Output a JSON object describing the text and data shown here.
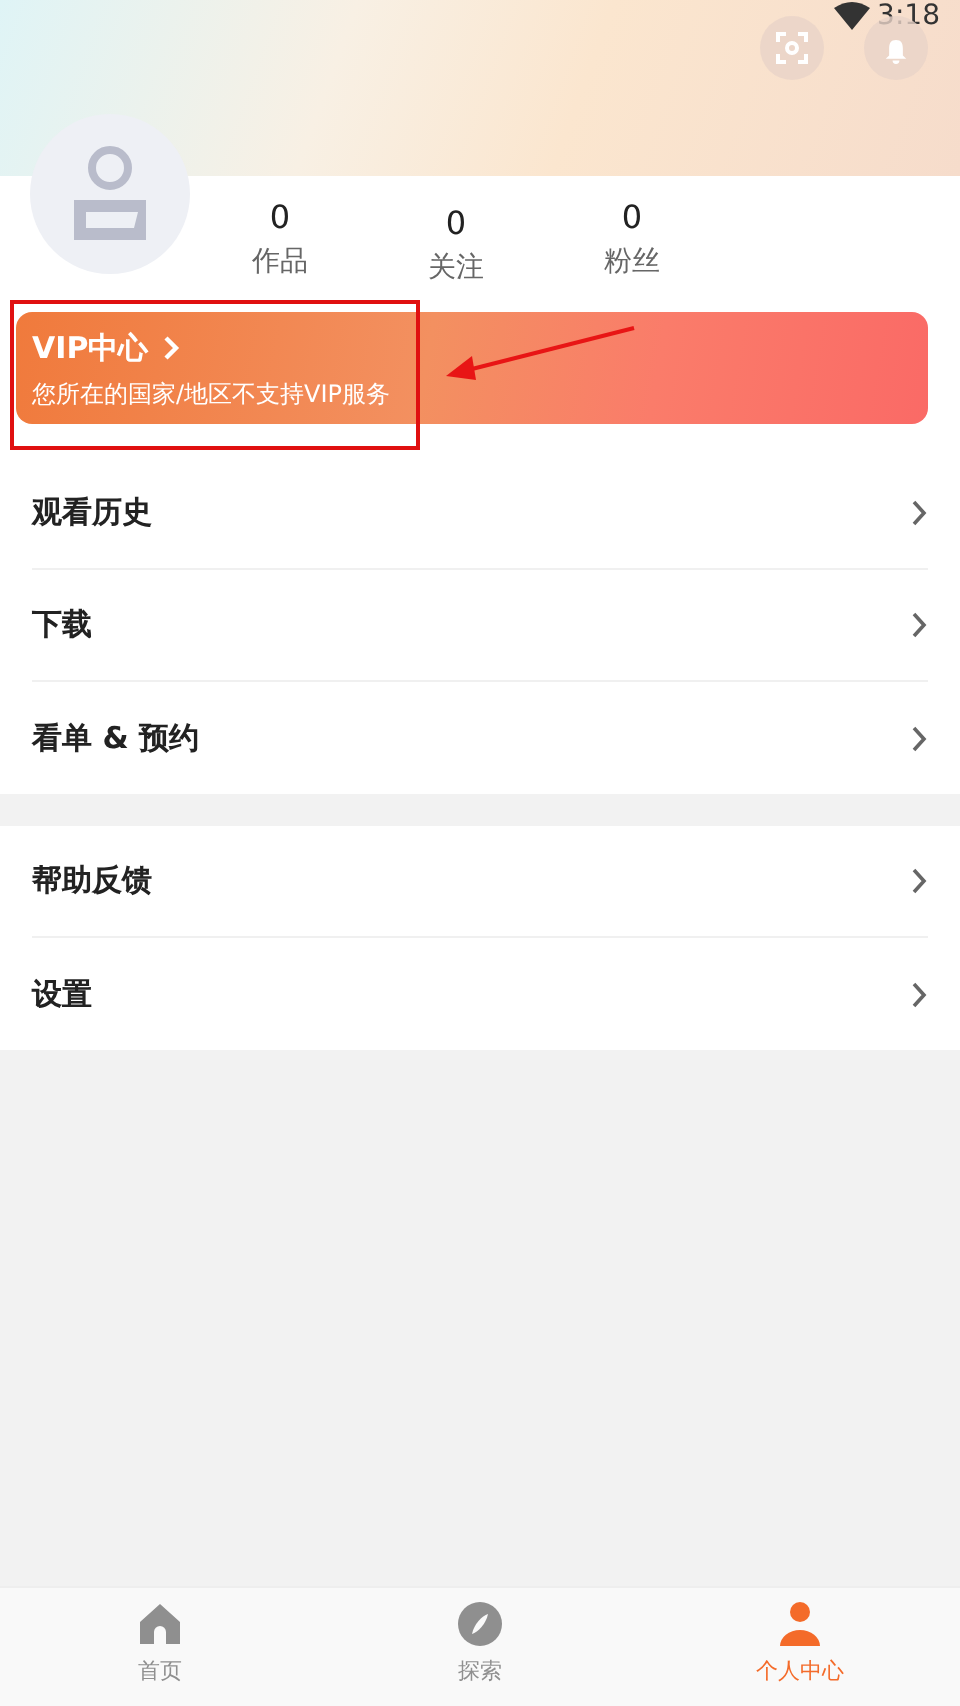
{
  "status_bar": {
    "time": "3:18"
  },
  "profile": {
    "stats": [
      {
        "value": "0",
        "label": "作品"
      },
      {
        "value": "0",
        "label": "关注"
      },
      {
        "value": "0",
        "label": "粉丝"
      }
    ]
  },
  "vip_card": {
    "title": "VIP中心",
    "subtitle": "您所在的国家/地区不支持VIP服务"
  },
  "menu_groups": [
    {
      "items": [
        {
          "label": "观看历史"
        },
        {
          "label": "下载"
        },
        {
          "label": "看单 & 预约"
        }
      ]
    },
    {
      "items": [
        {
          "label": "帮助反馈"
        },
        {
          "label": "设置"
        }
      ]
    }
  ],
  "bottom_nav": [
    {
      "kind": "home",
      "label": "首页",
      "selected": false
    },
    {
      "kind": "explore",
      "label": "探索",
      "selected": false
    },
    {
      "kind": "profile",
      "label": "个人中心",
      "selected": true
    }
  ]
}
